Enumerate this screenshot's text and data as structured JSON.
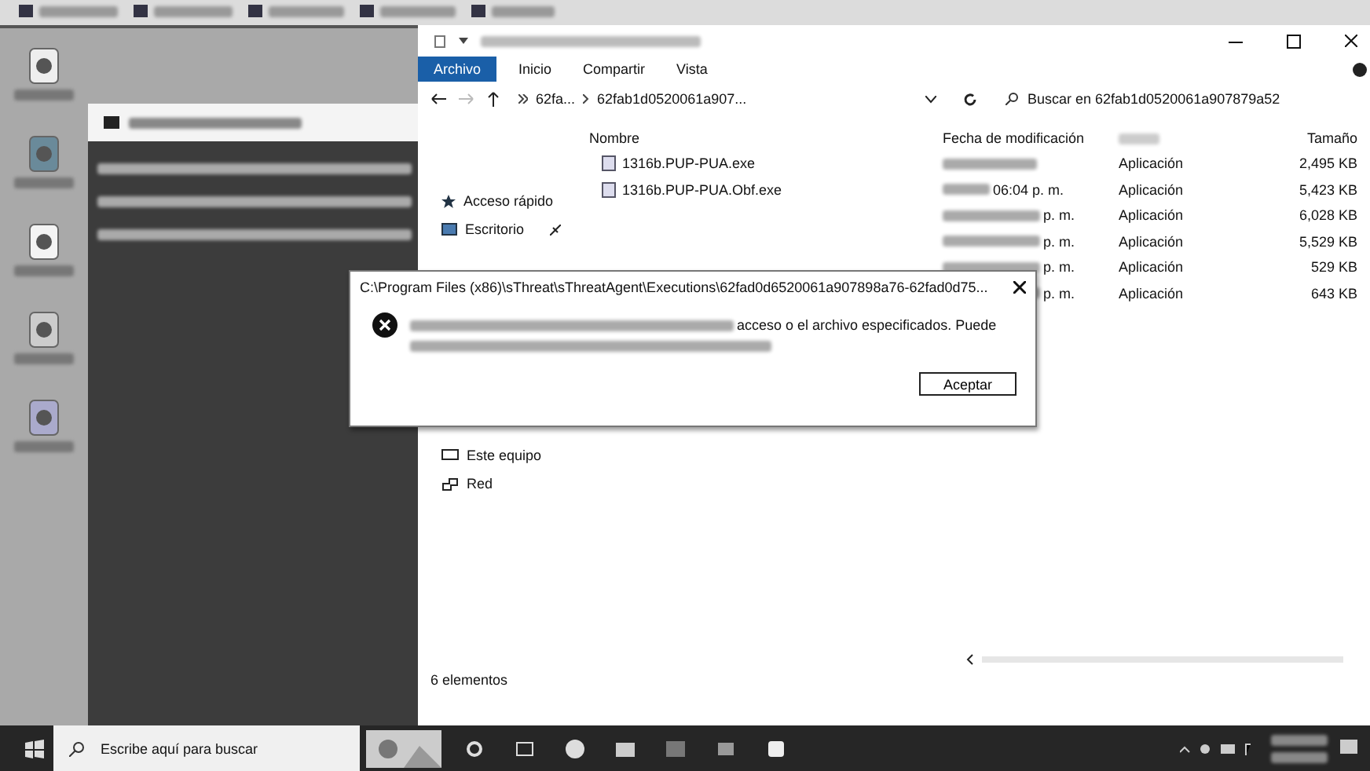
{
  "explorer": {
    "ribbon_tabs": [
      {
        "label": "Archivo",
        "kind": "file"
      },
      {
        "label": "Inicio",
        "kind": "tab"
      },
      {
        "label": "Compartir",
        "kind": "tab"
      },
      {
        "label": "Vista",
        "kind": "tab"
      }
    ],
    "breadcrumbs": [
      "62fa...",
      "62fab1d0520061a907..."
    ],
    "search": {
      "placeholder": "Buscar en 62fab1d0520061a907879a52"
    },
    "nav": [
      {
        "label": "Acceso rápido",
        "kind": "quick",
        "pinned": false
      },
      {
        "label": "Escritorio",
        "kind": "desktop",
        "pinned": true
      },
      {
        "label": "Este equipo",
        "kind": "pc",
        "pinned": false
      },
      {
        "label": "Red",
        "kind": "network",
        "pinned": false
      }
    ],
    "columns": {
      "name": "Nombre",
      "date": "Fecha de modificación",
      "size": "Tamaño"
    },
    "rows": [
      {
        "name": "1316b.PUP-PUA.exe",
        "type": "Aplicación",
        "size": "2,495 KB"
      },
      {
        "name": "1316b.PUP-PUA.Obf.exe",
        "date": "06:04 p. m.",
        "type": "Aplicación",
        "size": "5,423 KB"
      },
      {
        "date": "p. m.",
        "type": "Aplicación",
        "size": "6,028 KB"
      },
      {
        "date": "p. m.",
        "type": "Aplicación",
        "size": "5,529 KB"
      },
      {
        "date": "p. m.",
        "type": "Aplicación",
        "size": "529 KB"
      },
      {
        "date": "p. m.",
        "type": "Aplicación",
        "size": "643 KB"
      }
    ],
    "status": "6 elementos"
  },
  "dialog": {
    "title": "C:\\Program Files (x86)\\sThreat\\sThreatAgent\\Executions\\62fad0d6520061a907898a76-62fad0d75...",
    "message": "acceso o el archivo especificados. Puede",
    "button": "Aceptar"
  },
  "taskbar": {
    "search": {
      "placeholder": "Escribe aquí para buscar"
    }
  }
}
